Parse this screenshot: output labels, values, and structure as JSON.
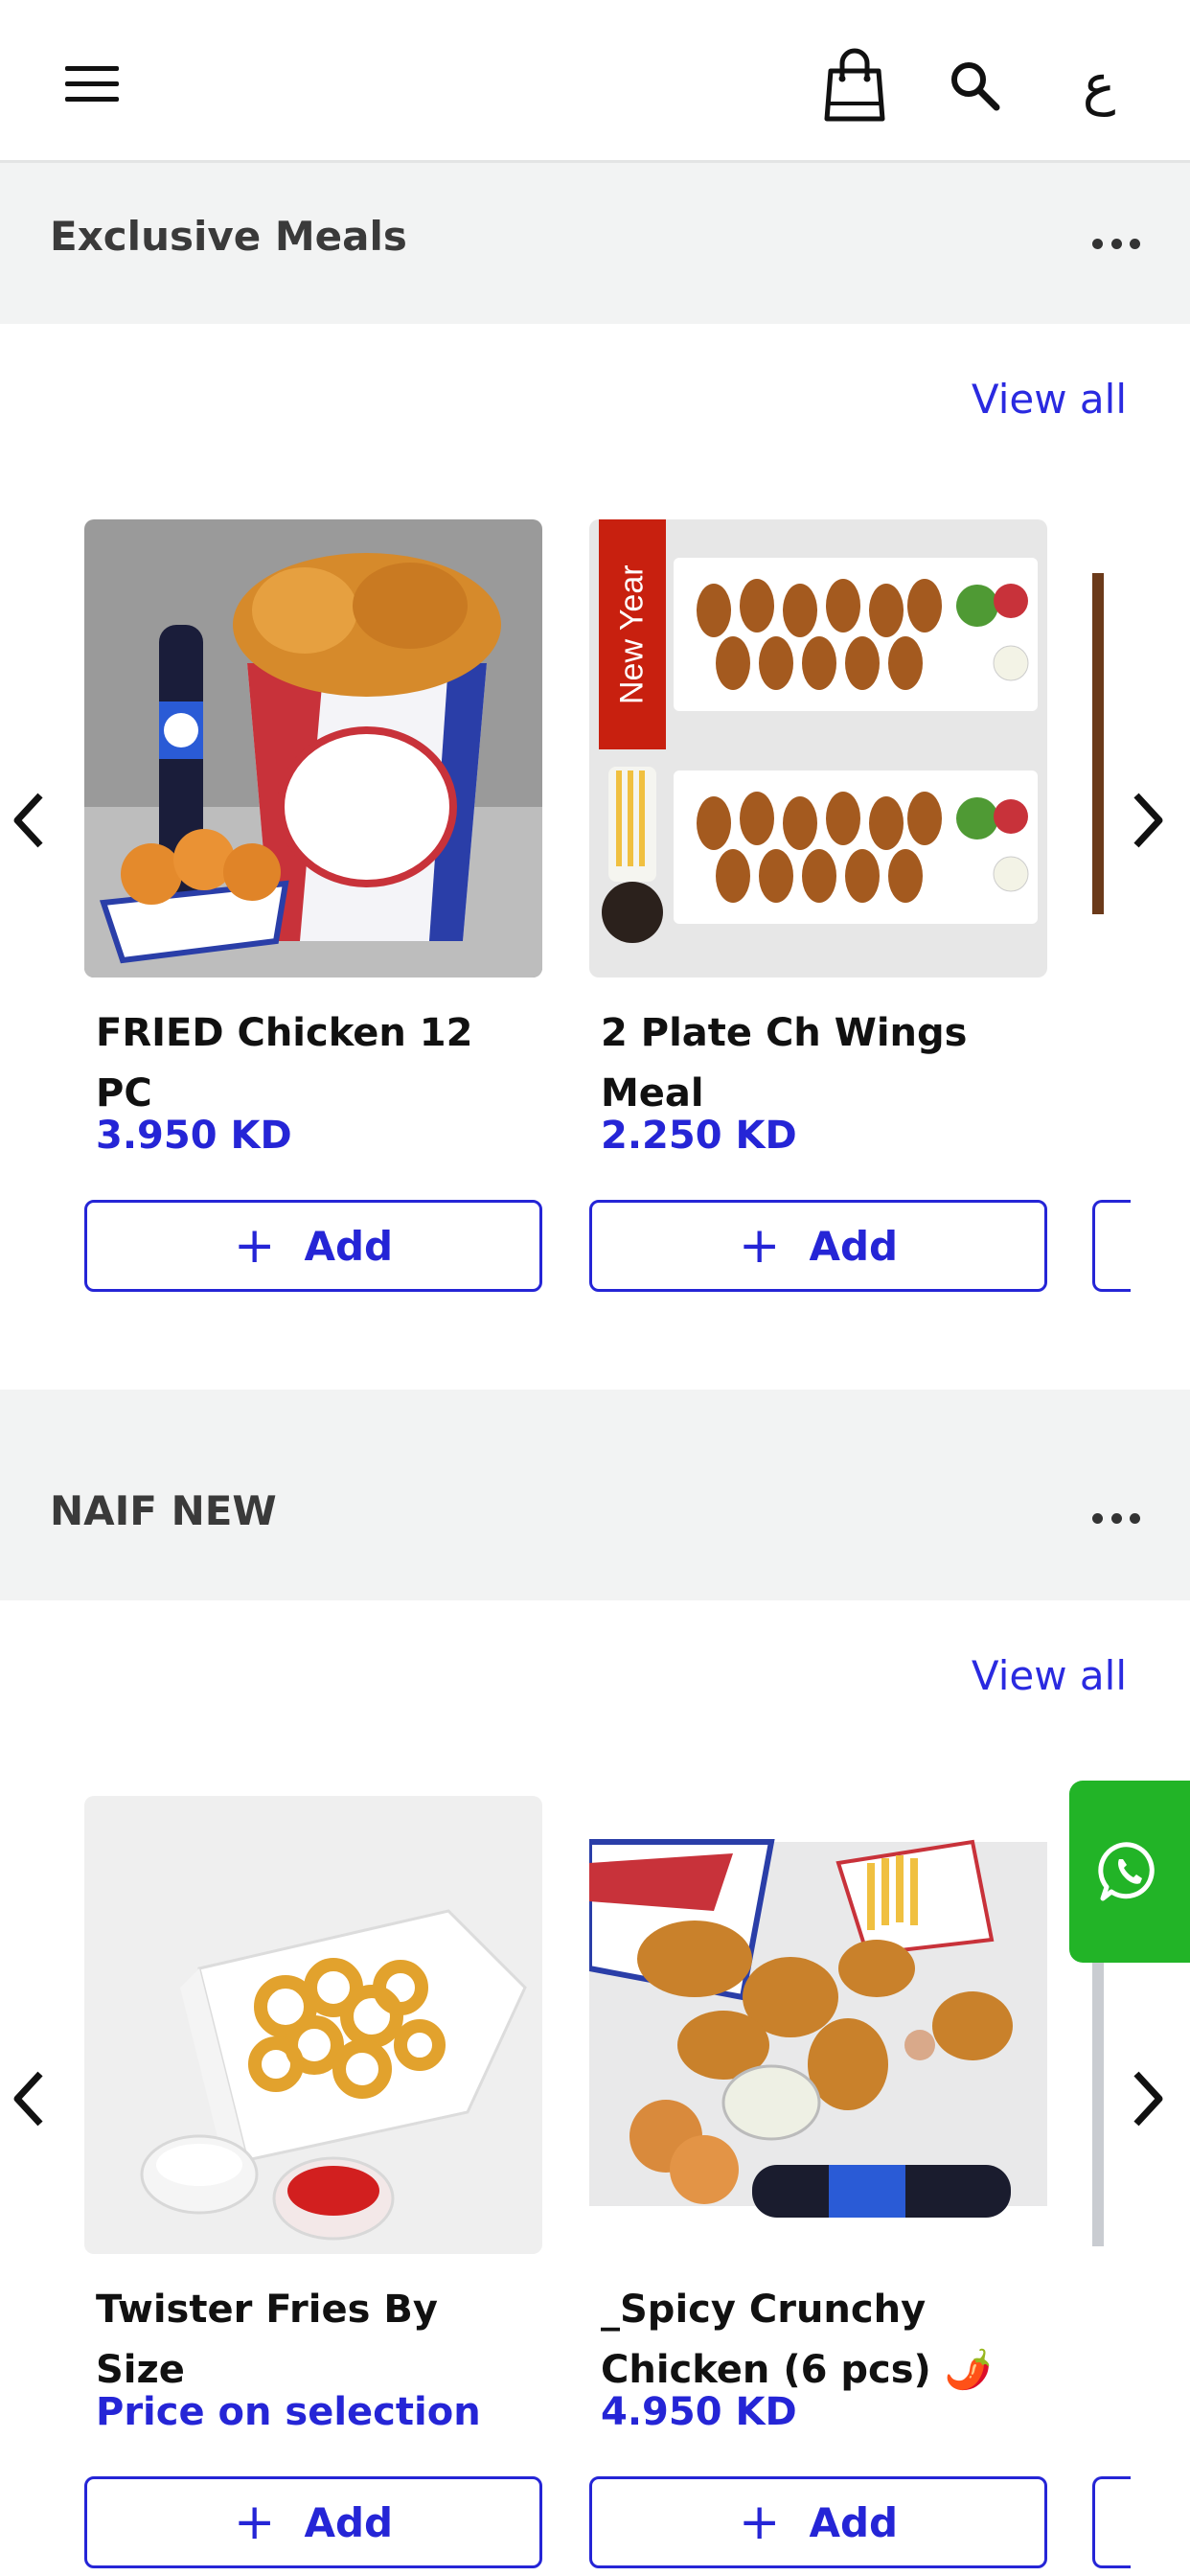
{
  "header": {
    "menu_icon": "hamburger-menu-icon",
    "bag_icon": "shopping-bag-icon",
    "search_icon": "search-icon",
    "language_label": "ع"
  },
  "sections": [
    {
      "title": "Exclusive Meals",
      "view_all": "View all",
      "items": [
        {
          "name": "FRIED Chicken 12 PC",
          "price": "3.950 KD",
          "add_label": "Add",
          "image": "fried-chicken-bucket-image"
        },
        {
          "name": "2 Plate Ch Wings Meal",
          "price": "2.250 KD",
          "add_label": "Add",
          "image": "wings-plate-image",
          "ribbon": "New Year"
        }
      ]
    },
    {
      "title": "NAIF NEW",
      "view_all": "View all",
      "items": [
        {
          "name": "Twister Fries By Size",
          "price": "Price on selection",
          "add_label": "Add",
          "image": "twister-fries-image"
        },
        {
          "name": "_Spicy Crunchy Chicken (6 pcs) 🌶️",
          "price": "4.950 KD",
          "add_label": "Add",
          "image": "spicy-crunchy-chicken-image"
        }
      ]
    }
  ],
  "whatsapp_icon": "whatsapp-icon",
  "colors": {
    "accent": "#2525d6",
    "whatsapp": "#22b427",
    "section_bg": "#f2f3f3"
  }
}
